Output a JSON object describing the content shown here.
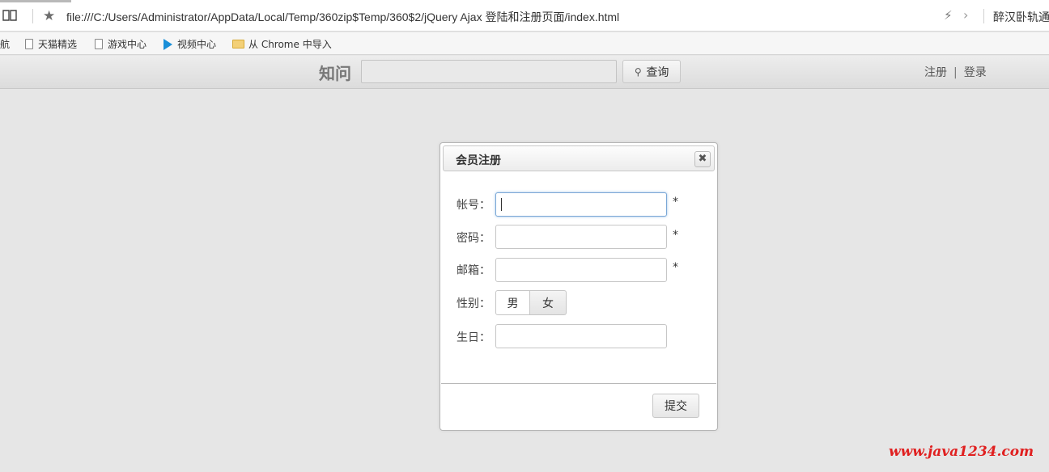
{
  "browser": {
    "url": "file:///C:/Users/Administrator/AppData/Local/Temp/360zip$Temp/360$2/jQuery Ajax 登陆和注册页面/index.html",
    "extension_text": "醉汉卧轨通俗",
    "bookmarks": [
      {
        "label": "航",
        "icon": "none"
      },
      {
        "label": "天猫精选",
        "icon": "doc-icon"
      },
      {
        "label": "游戏中心",
        "icon": "doc-icon"
      },
      {
        "label": "视频中心",
        "icon": "play-icon"
      },
      {
        "label": "从 Chrome 中导入",
        "icon": "folder-icon"
      }
    ]
  },
  "header": {
    "brand": "知问",
    "search_value": "",
    "search_button": "查询",
    "register_link": "注册",
    "separator": "|",
    "login_link": "登录"
  },
  "dialog": {
    "title": "会员注册",
    "close_symbol": "✖",
    "fields": {
      "account_label": "帐号：",
      "password_label": "密码：",
      "email_label": "邮箱：",
      "gender_label": "性别：",
      "birthday_label": "生日："
    },
    "required_mark": "*",
    "gender_options": [
      "男",
      "女"
    ],
    "submit_label": "提交"
  },
  "watermark": "www.java1234.com"
}
